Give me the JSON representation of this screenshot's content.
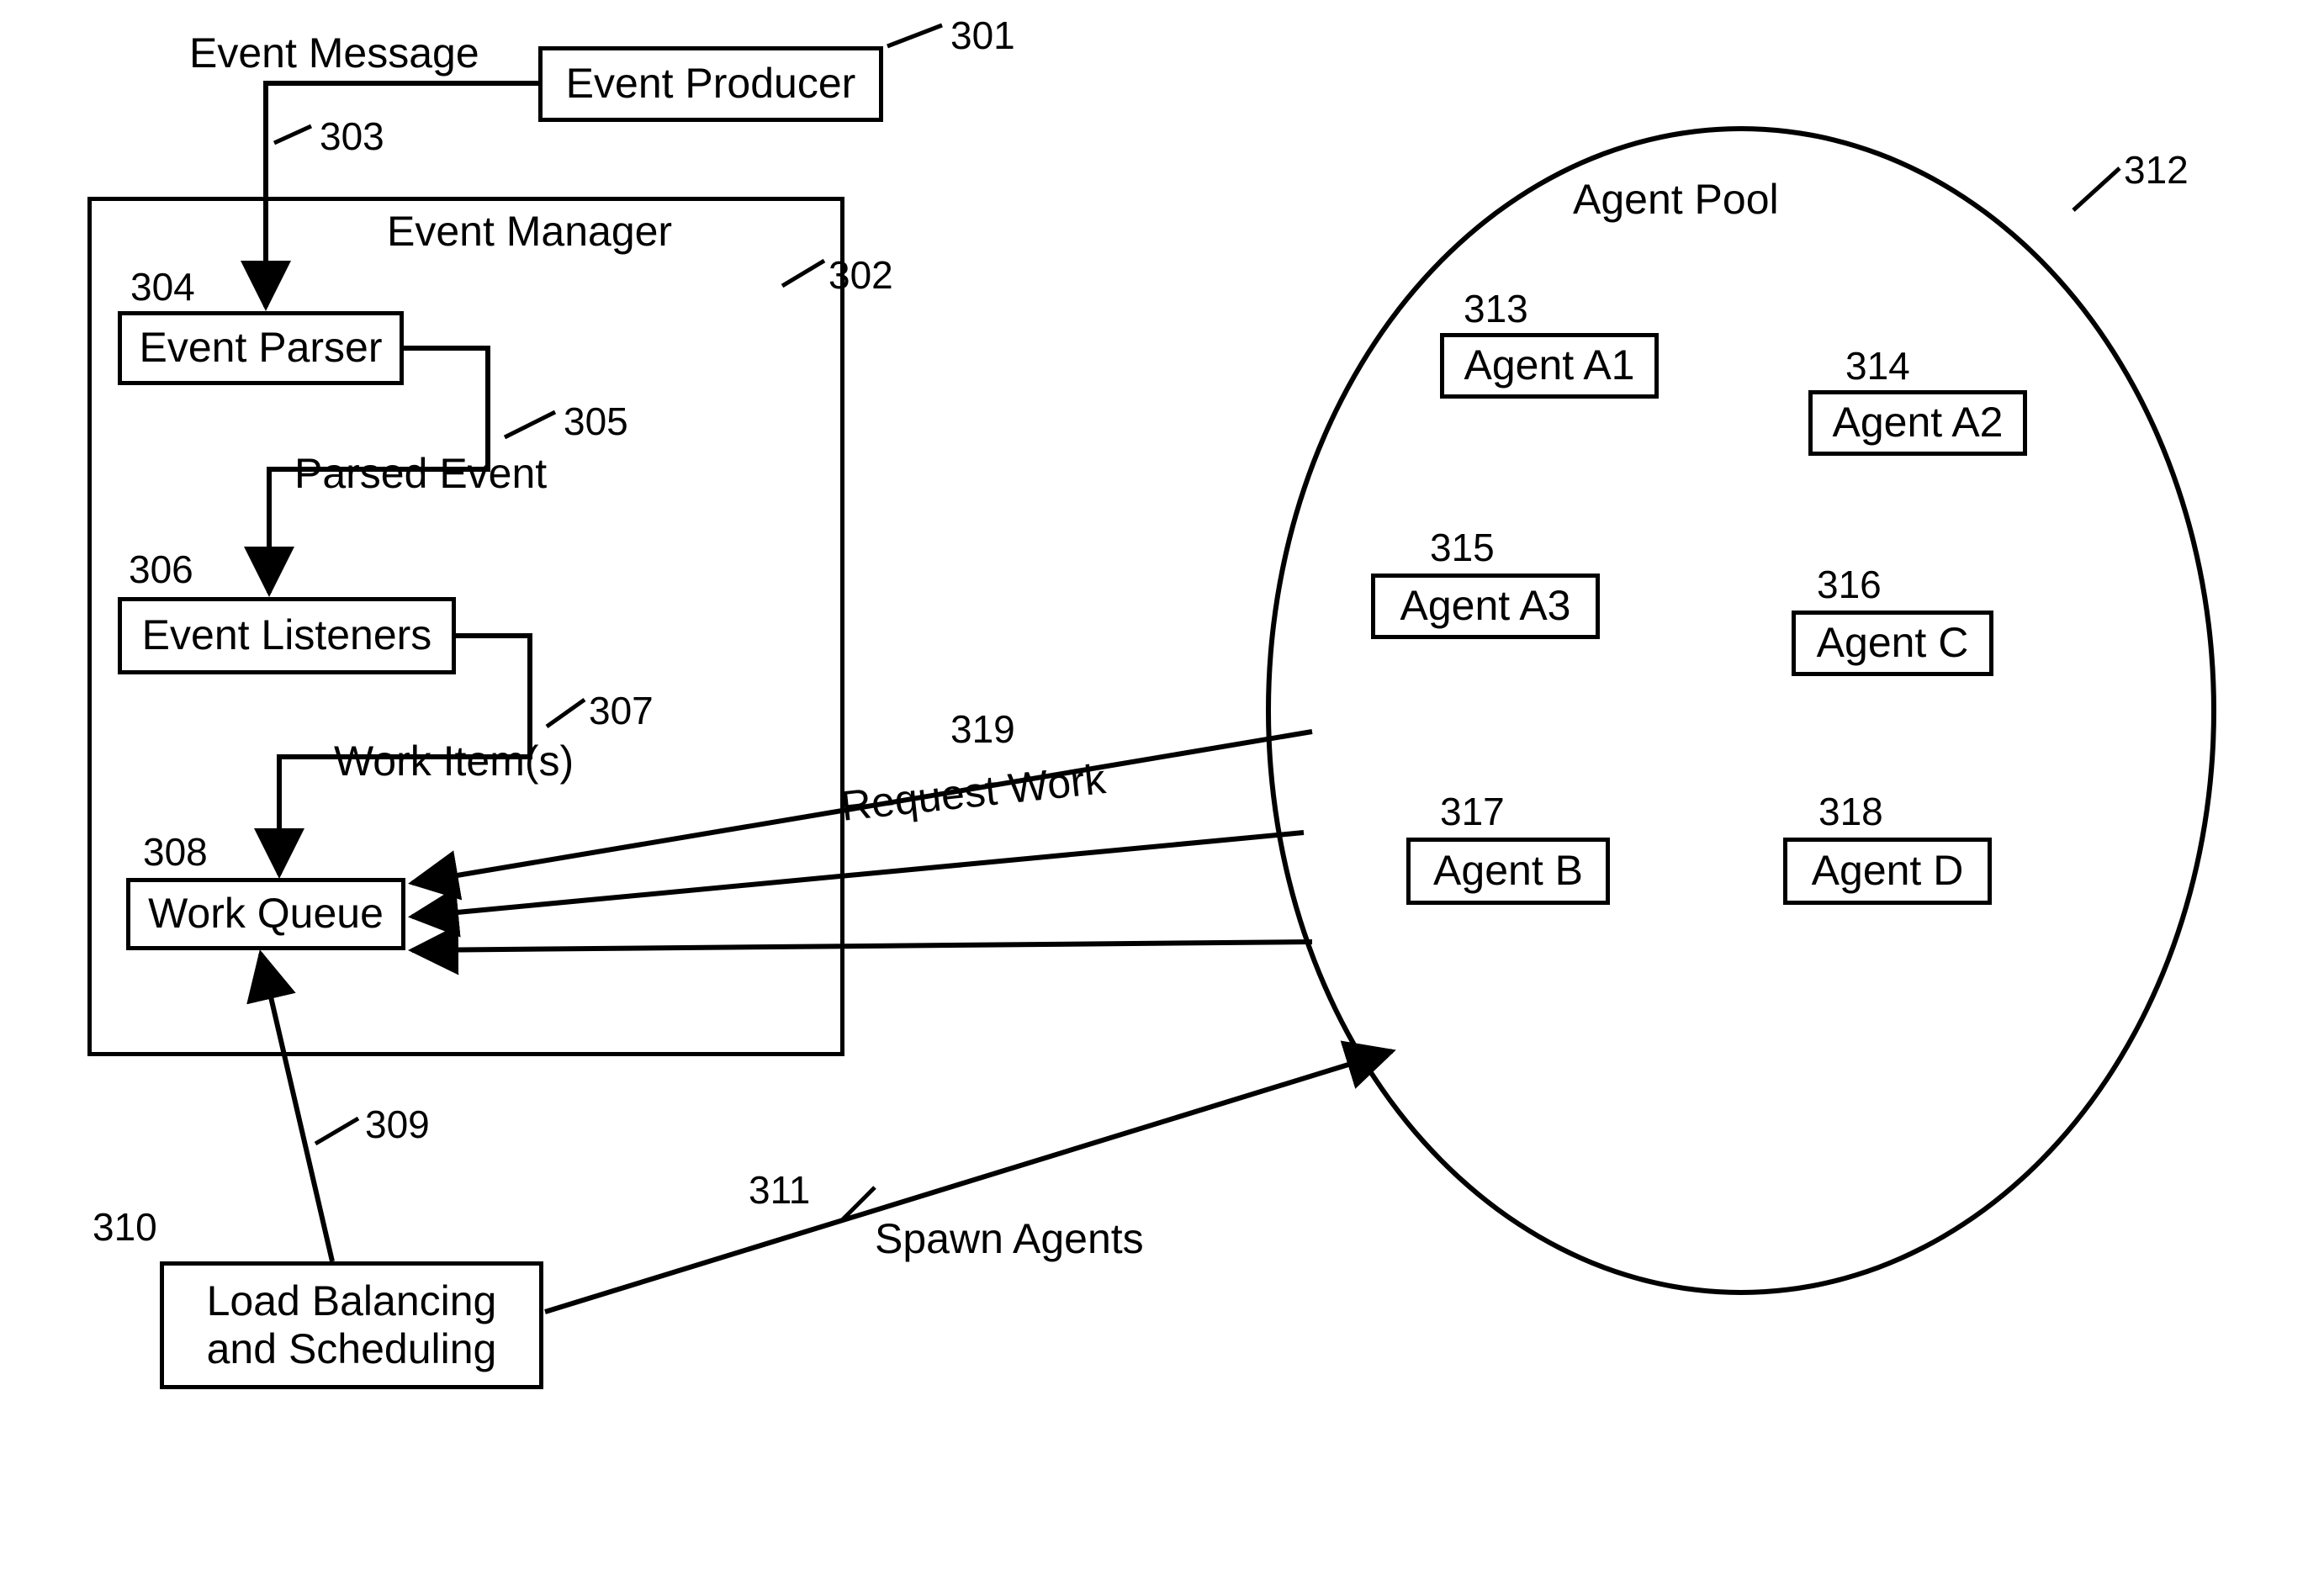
{
  "nodes": {
    "event_producer": {
      "label": "Event Producer",
      "ref": "301"
    },
    "event_manager": {
      "label": "Event Manager",
      "ref": "302"
    },
    "event_parser": {
      "label": "Event Parser",
      "ref": "304"
    },
    "event_listeners": {
      "label": "Event Listeners",
      "ref": "306"
    },
    "work_queue": {
      "label": "Work Queue",
      "ref": "308"
    },
    "load_balancing": {
      "label": "Load Balancing\nand Scheduling",
      "ref": "310"
    },
    "agent_pool": {
      "label": "Agent Pool",
      "ref": "312"
    },
    "agent_a1": {
      "label": "Agent A1",
      "ref": "313"
    },
    "agent_a2": {
      "label": "Agent A2",
      "ref": "314"
    },
    "agent_a3": {
      "label": "Agent A3",
      "ref": "315"
    },
    "agent_c": {
      "label": "Agent C",
      "ref": "316"
    },
    "agent_b": {
      "label": "Agent B",
      "ref": "317"
    },
    "agent_d": {
      "label": "Agent D",
      "ref": "318"
    }
  },
  "edges": {
    "event_message": {
      "label": "Event Message",
      "ref": "303"
    },
    "parsed_event": {
      "label": "Parsed Event",
      "ref": "305"
    },
    "work_items": {
      "label": "Work Item(s)",
      "ref": "307"
    },
    "lb_to_queue": {
      "label": "",
      "ref": "309"
    },
    "spawn_agents": {
      "label": "Spawn Agents",
      "ref": "311"
    },
    "request_work": {
      "label": "Request Work",
      "ref": "319"
    }
  }
}
